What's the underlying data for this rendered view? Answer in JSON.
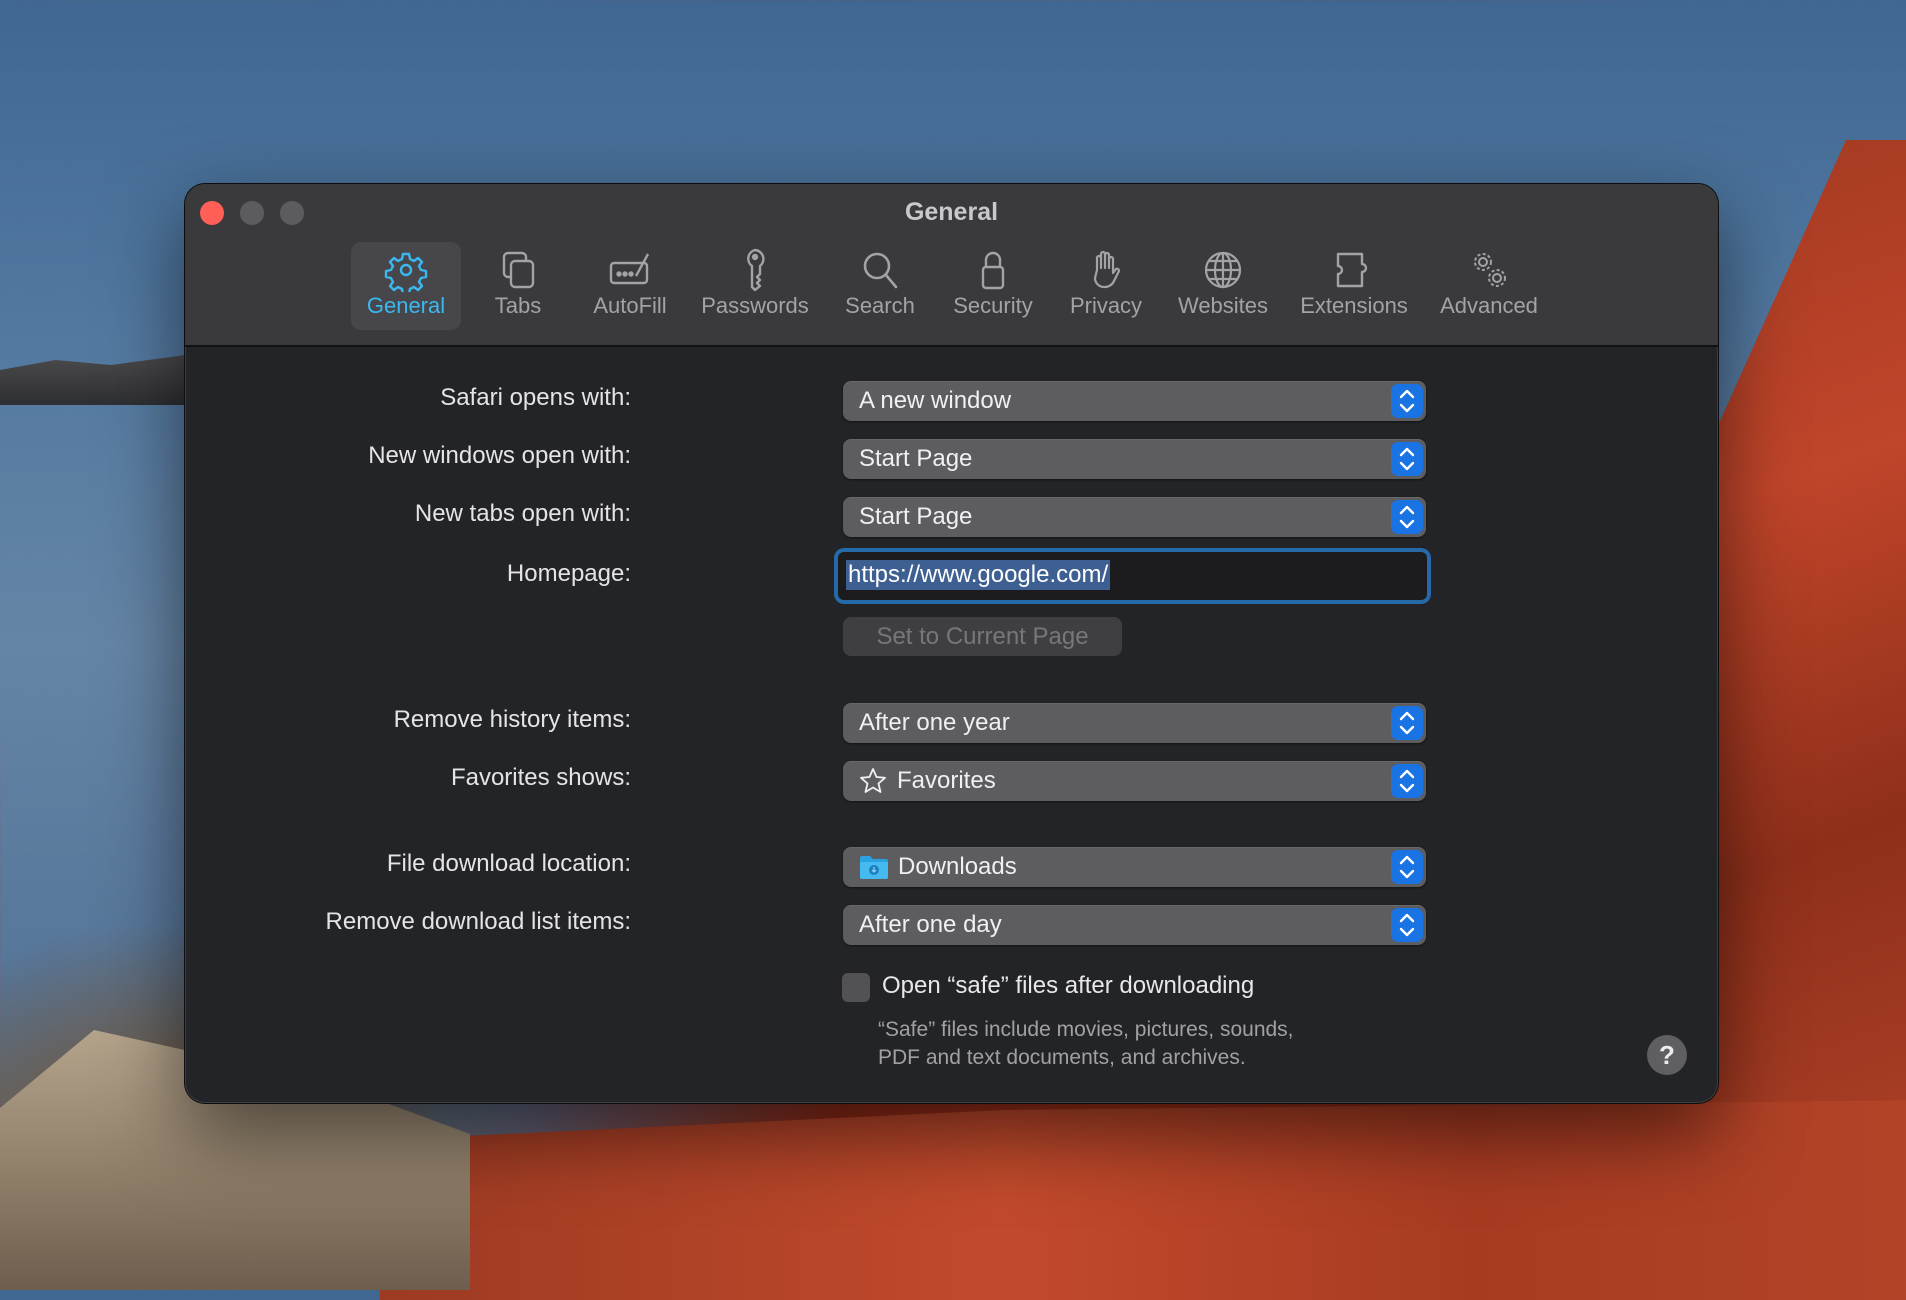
{
  "window": {
    "title": "General",
    "traffic_lights": [
      "close",
      "minimize",
      "zoom"
    ]
  },
  "toolbar": {
    "selected": "General",
    "accent_color": "#3bb8f0",
    "tabs": [
      {
        "label": "General",
        "icon": "gear-icon"
      },
      {
        "label": "Tabs",
        "icon": "tabs-icon"
      },
      {
        "label": "AutoFill",
        "icon": "autofill-icon"
      },
      {
        "label": "Passwords",
        "icon": "key-icon"
      },
      {
        "label": "Search",
        "icon": "search-icon"
      },
      {
        "label": "Security",
        "icon": "lock-icon"
      },
      {
        "label": "Privacy",
        "icon": "hand-icon"
      },
      {
        "label": "Websites",
        "icon": "globe-icon"
      },
      {
        "label": "Extensions",
        "icon": "puzzle-icon"
      },
      {
        "label": "Advanced",
        "icon": "gears-icon"
      }
    ]
  },
  "form": {
    "safari_opens_with": {
      "label": "Safari opens with:",
      "value": "A new window"
    },
    "new_windows_open_with": {
      "label": "New windows open with:",
      "value": "Start Page"
    },
    "new_tabs_open_with": {
      "label": "New tabs open with:",
      "value": "Start Page"
    },
    "homepage": {
      "label": "Homepage:",
      "value": "https://www.google.com/"
    },
    "set_current_page_button": "Set to Current Page",
    "remove_history_items": {
      "label": "Remove history items:",
      "value": "After one year"
    },
    "favorites_shows": {
      "label": "Favorites shows:",
      "value": "Favorites",
      "icon": "star-icon"
    },
    "file_download_location": {
      "label": "File download location:",
      "value": "Downloads",
      "icon": "downloads-folder-icon"
    },
    "remove_download_list_items": {
      "label": "Remove download list items:",
      "value": "After one day"
    },
    "open_safe_files": {
      "label": "Open “safe” files after downloading",
      "checked": false
    },
    "safe_files_note": [
      "“Safe” files include movies, pictures, sounds,",
      "PDF and text documents, and archives."
    ],
    "help_button": "?"
  },
  "colors": {
    "chevron_button": "#1a73e3",
    "focus_ring": "#2669a8",
    "close_button": "#ff5f57"
  }
}
